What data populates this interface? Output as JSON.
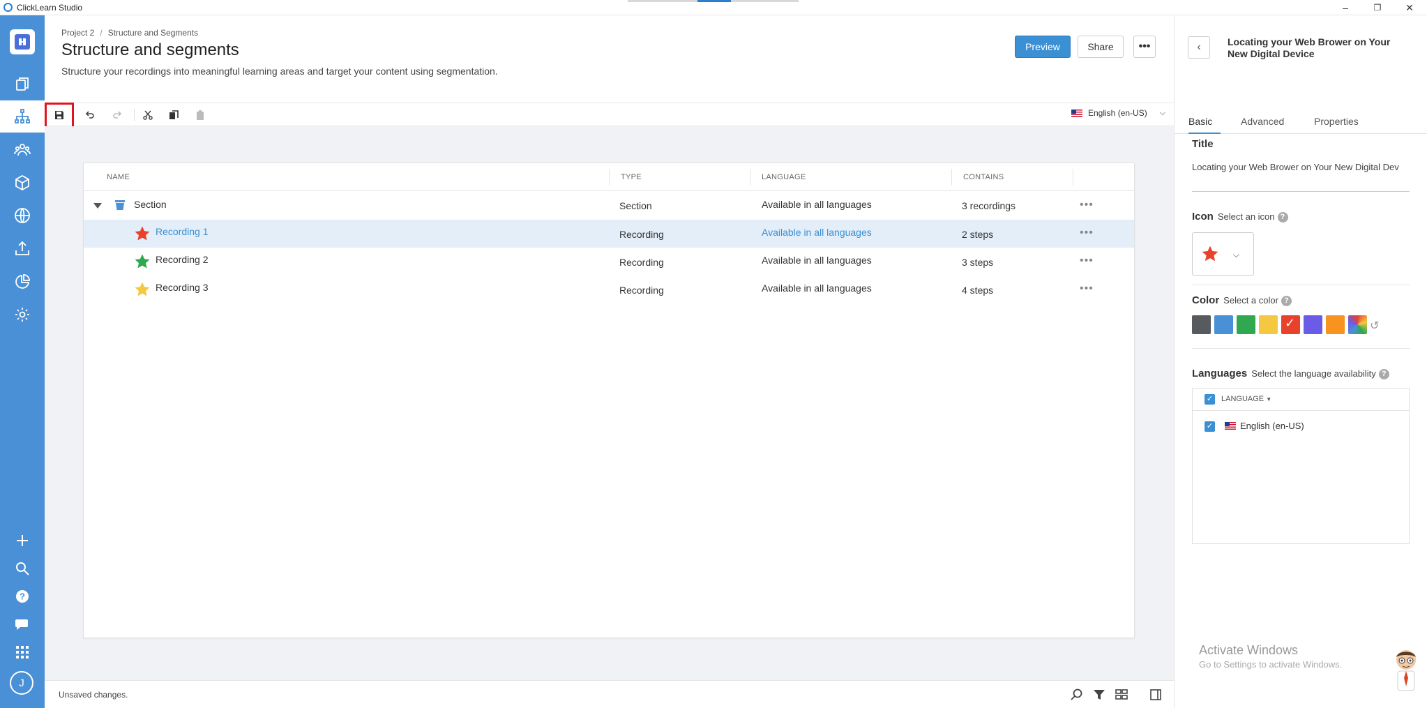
{
  "app": {
    "title": "ClickLearn Studio"
  },
  "window": {
    "minimize": "–",
    "restore": "❐",
    "close": "✕"
  },
  "rail": {
    "items": [
      "pages-icon",
      "structure-icon",
      "users-icon",
      "package-icon",
      "globe-icon",
      "publish-icon",
      "analytics-icon",
      "settings-icon"
    ],
    "bottom": [
      "add-icon",
      "search-icon",
      "help-icon",
      "chat-icon",
      "apps-icon"
    ],
    "avatar": "J"
  },
  "header": {
    "breadcrumb": [
      "Project 2",
      "Structure and Segments"
    ],
    "breadcrumb_sep": "/",
    "title": "Structure and segments",
    "subtitle": "Structure your recordings into meaningful learning areas and target your content using segmentation.",
    "preview": "Preview",
    "share": "Share",
    "more": "•••"
  },
  "toolbar": {
    "language": "English (en-US)"
  },
  "grid": {
    "columns": [
      "NAME",
      "TYPE",
      "LANGUAGE",
      "CONTAINS"
    ],
    "rows": [
      {
        "name": "Section",
        "type": "Section",
        "language": "Available in all languages",
        "contains": "3 recordings",
        "icon": "section-icon"
      },
      {
        "name": "Recording 1",
        "type": "Recording",
        "language": "Available in all languages",
        "contains": "2 steps",
        "icon": "red-star-icon",
        "selected": true
      },
      {
        "name": "Recording 2",
        "type": "Recording",
        "language": "Available in all languages",
        "contains": "3 steps",
        "icon": "green-star-icon"
      },
      {
        "name": "Recording 3",
        "type": "Recording",
        "language": "Available in all languages",
        "contains": "4 steps",
        "icon": "yellow-star-icon"
      }
    ],
    "row_menu": "•••"
  },
  "status": {
    "text": "Unsaved changes."
  },
  "panel": {
    "title": "Locating your Web Brower on Your New Digital Device",
    "tabs": [
      "Basic",
      "Advanced",
      "Properties"
    ],
    "title_label": "Title",
    "title_value": "Locating your Web Brower on Your New Digital Dev",
    "icon_label": "Icon",
    "icon_hint": "Select an icon",
    "color_label": "Color",
    "color_hint": "Select a color",
    "colors": [
      "#575a5e",
      "#4a90d6",
      "#2fa84f",
      "#f5c842",
      "#e8412c",
      "#6b5ce7",
      "#f7931e",
      "rainbow"
    ],
    "selected_color": "#e8412c",
    "languages_label": "Languages",
    "languages_hint": "Select the language availability",
    "lang_column": "LANGUAGE",
    "lang_item": "English (en-US)",
    "help": "?"
  },
  "watermark": {
    "line1": "Activate Windows",
    "line2": "Go to Settings to activate Windows."
  }
}
